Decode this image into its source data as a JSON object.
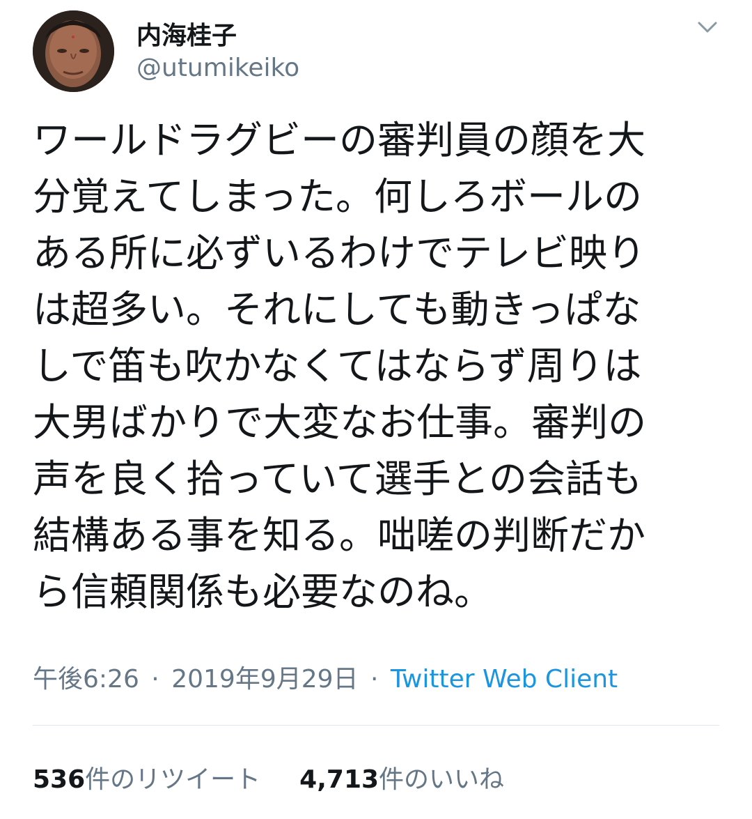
{
  "author": {
    "display_name": "内海桂子",
    "handle": "@utumikeiko"
  },
  "menu_icon": "chevron-down-icon",
  "tweet": {
    "lines": [
      "ワールドラグビーの審判員の顔を大",
      "分覚えてしまった。何しろボールの",
      "ある所に必ずいるわけでテレビ映り",
      "は超多い。それにしても動きっぱな",
      "しで笛も吹かなくてはならず周りは",
      "大男ばかりで大変なお仕事。審判の",
      "声を良く拾っていて選手との会話も",
      "結構ある事を知る。咄嗟の判断だか",
      "ら信頼関係も必要なのね。"
    ]
  },
  "meta": {
    "time": "午後6:26",
    "separator": "·",
    "date": "2019年9月29日",
    "source": "Twitter Web Client"
  },
  "stats": {
    "retweets_count": "536",
    "retweets_label": "件のリツイート",
    "likes_count": "4,713",
    "likes_label": "件のいいね"
  },
  "colors": {
    "text": "#14171a",
    "secondary": "#657786",
    "link": "#1b95e0",
    "divider": "#e1e8ed"
  }
}
